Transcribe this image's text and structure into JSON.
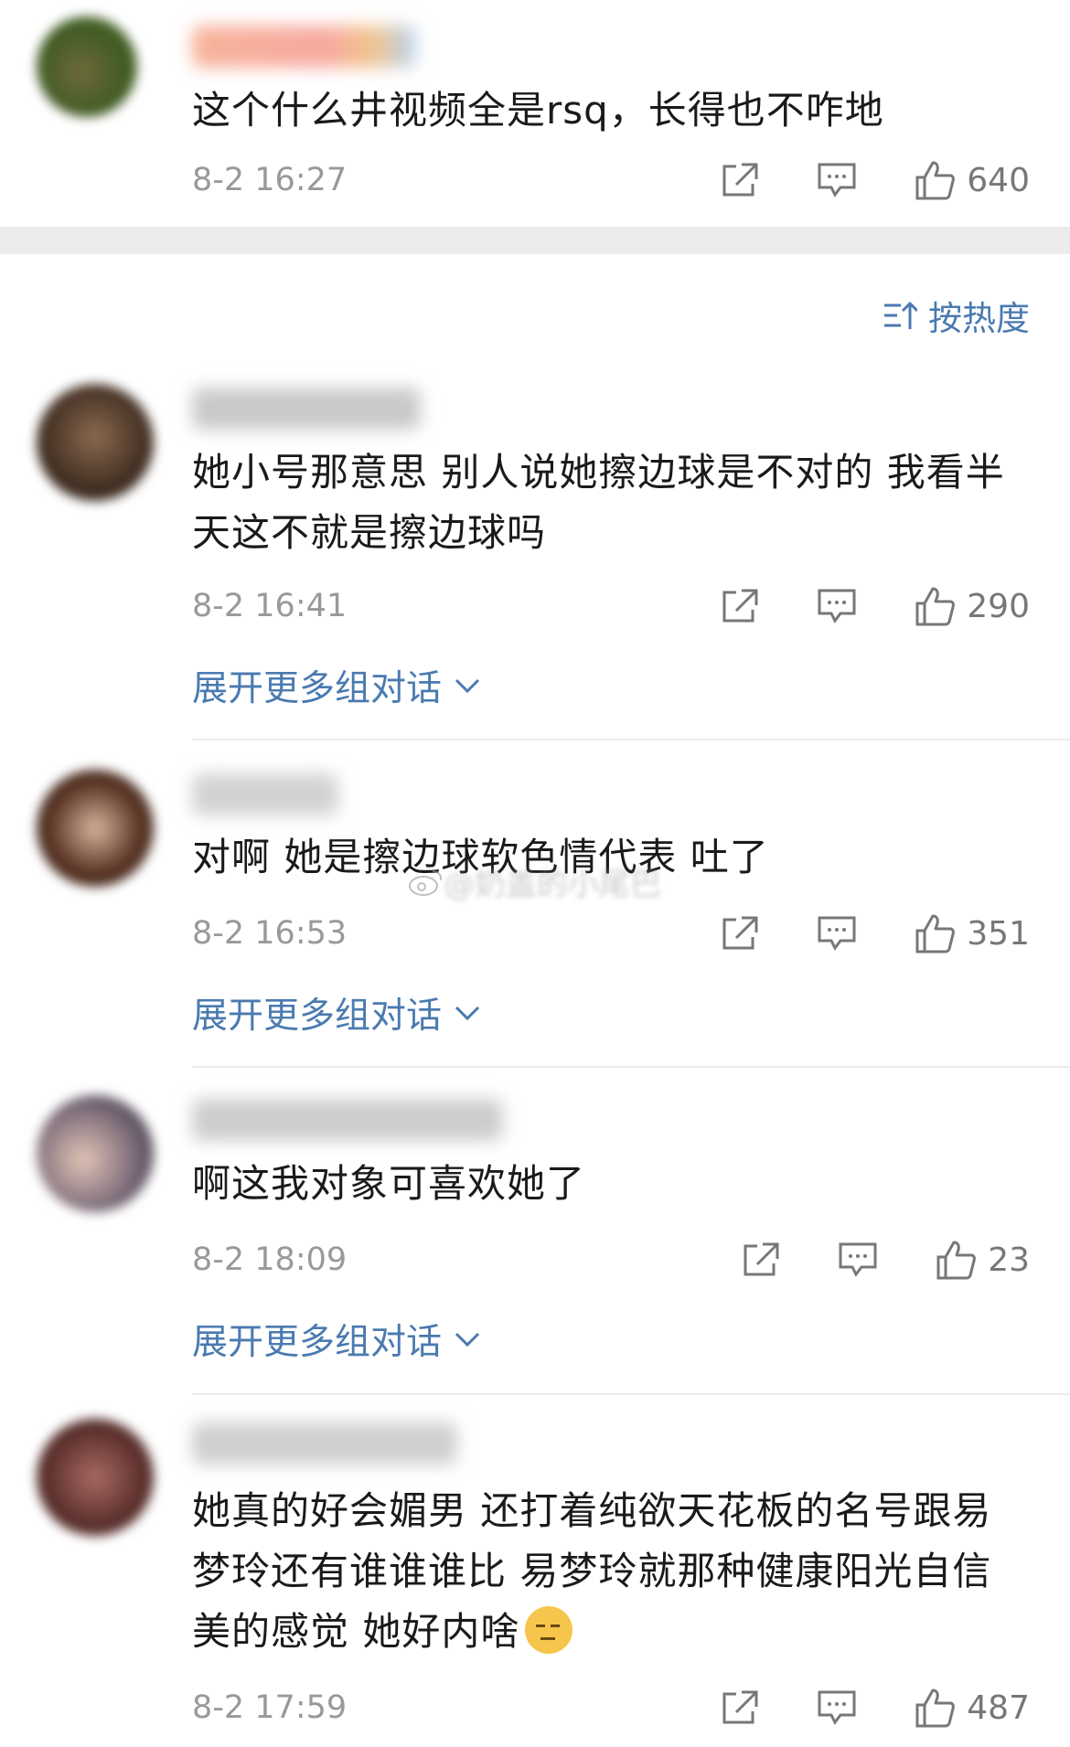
{
  "top_comment": {
    "text": "这个什么井视频全是rsq，长得也不咋地",
    "time": "8-2 16:27",
    "likes": "640",
    "name_color": "#f6a78a"
  },
  "sort": {
    "label": "按热度",
    "icon": "sort-icon"
  },
  "comments": [
    {
      "text": "她小号那意思 别人说她擦边球是不对的 我看半天这不就是擦边球吗",
      "time": "8-2 16:41",
      "likes": "290",
      "expand": "展开更多组对话"
    },
    {
      "text": "对啊 她是擦边球软色情代表 吐了",
      "time": "8-2 16:53",
      "likes": "351",
      "expand": "展开更多组对话"
    },
    {
      "text": "啊这我对象可喜欢她了",
      "time": "8-2 18:09",
      "likes": "23",
      "expand": "展开更多组对话"
    },
    {
      "text": "她真的好会媚男 还打着纯欲天花板的名号跟易梦玲还有谁谁谁比 易梦玲就那种健康阳光自信美的感觉 她好内啥",
      "time": "8-2 17:59",
      "likes": "487"
    }
  ],
  "watermark": {
    "text": "@奶盖的小尾巴"
  },
  "colors": {
    "link": "#4a7ab0",
    "meta": "#999999",
    "separator": "#ececec"
  }
}
